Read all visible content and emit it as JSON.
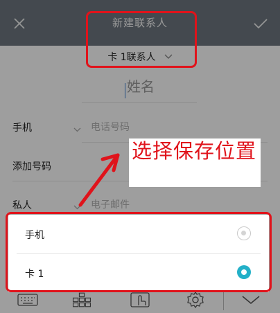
{
  "header": {
    "title": "新建联系人",
    "close_icon": "close-icon",
    "confirm_icon": "check-icon"
  },
  "storage": {
    "selected": "卡 1联系人"
  },
  "name_field": {
    "placeholder": "姓名"
  },
  "fields": [
    {
      "label": "手机",
      "placeholder": "电话号码"
    },
    {
      "label": "添加号码"
    },
    {
      "label": "私人",
      "placeholder": "电子邮件"
    }
  ],
  "sheet": {
    "options": [
      {
        "label": "手机",
        "selected": false
      },
      {
        "label": "卡 1",
        "selected": true
      }
    ]
  },
  "annotation": {
    "text": "选择保存位置"
  },
  "colors": {
    "titlebar": "#6f7780",
    "accent": "#23b0c8",
    "annotation_red": "#e0131b"
  }
}
